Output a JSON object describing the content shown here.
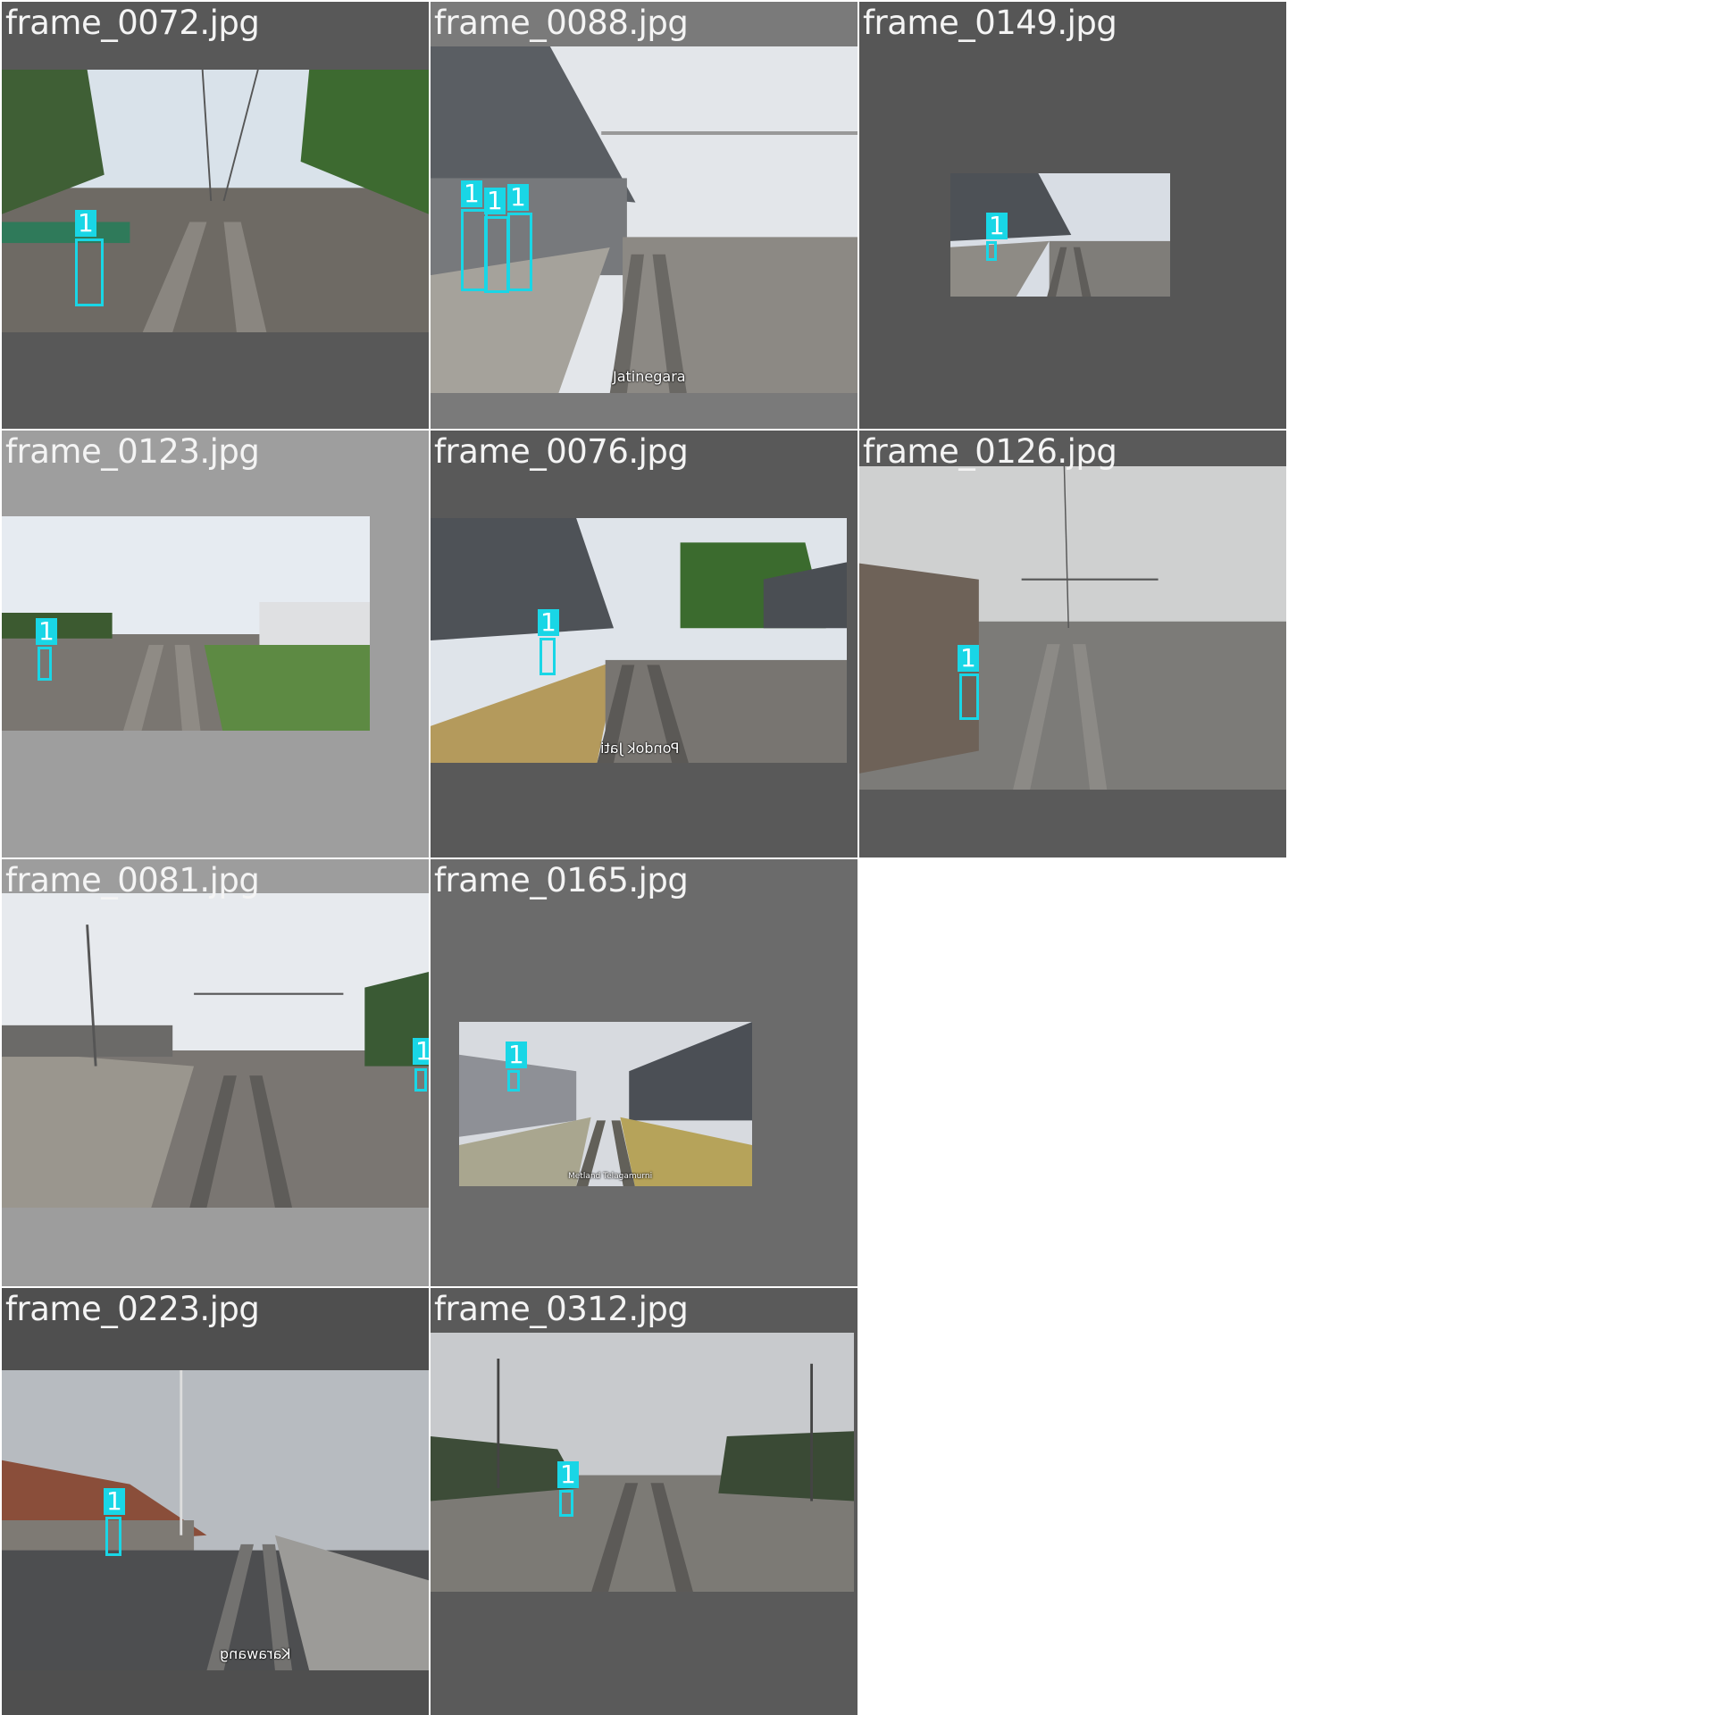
{
  "tiles": [
    {
      "filename": "frame_0072.jpg",
      "caption": "",
      "detections": [
        {
          "label": "1"
        }
      ]
    },
    {
      "filename": "frame_0088.jpg",
      "caption": "Jatinegara",
      "detections": [
        {
          "label": "1"
        },
        {
          "label": "1"
        },
        {
          "label": "1"
        }
      ]
    },
    {
      "filename": "frame_0149.jpg",
      "caption": "",
      "detections": [
        {
          "label": "1"
        }
      ]
    },
    {
      "filename": "frame_0123.jpg",
      "caption": "",
      "detections": [
        {
          "label": "1"
        }
      ]
    },
    {
      "filename": "frame_0076.jpg",
      "caption": "Pondok Jati",
      "detections": [
        {
          "label": "1"
        }
      ]
    },
    {
      "filename": "frame_0126.jpg",
      "caption": "",
      "detections": [
        {
          "label": "1"
        }
      ]
    },
    {
      "filename": "frame_0081.jpg",
      "caption": "",
      "detections": [
        {
          "label": "1"
        }
      ]
    },
    {
      "filename": "frame_0165.jpg",
      "caption": "Metland Telagamurni",
      "detections": [
        {
          "label": "1"
        }
      ]
    },
    {
      "filename": "frame_0223.jpg",
      "caption": "Karawang",
      "detections": [
        {
          "label": "1"
        }
      ]
    },
    {
      "filename": "frame_0312.jpg",
      "caption": "",
      "detections": [
        {
          "label": "1"
        }
      ]
    }
  ],
  "colors": {
    "box": "#19d6e6",
    "title_text": "#f4f4f4"
  }
}
